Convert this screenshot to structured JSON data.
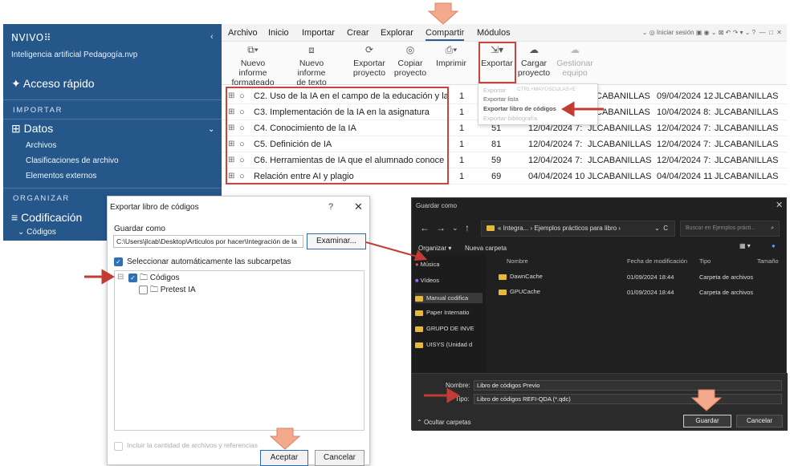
{
  "nvivo": {
    "logo": "NVIVO⠿",
    "project": "Inteligencia artificial Pedagogía.nvp",
    "quick_access": "Acceso rápido",
    "sec_import": "IMPORTAR",
    "group_data": "Datos",
    "sub_items": [
      "Archivos",
      "Clasificaciones de archivo",
      "Elementos externos"
    ],
    "sec_organize": "ORGANIZAR",
    "group_coding": "Codificación",
    "sub_codes": "Códigos",
    "menu": [
      "Archivo",
      "Inicio",
      "Importar",
      "Crear",
      "Explorar",
      "Compartir",
      "Módulos"
    ],
    "topright": "Iniciar sesión",
    "ribbon": [
      {
        "label": "Nuevo informe\nformateado",
        "icon": "report-icon"
      },
      {
        "label": "Nuevo informe\nde texto",
        "icon": "text-report-icon"
      },
      {
        "label": "Exportar\nproyecto",
        "icon": "export-project-icon"
      },
      {
        "label": "Copiar\nproyecto",
        "icon": "copy-project-icon"
      },
      {
        "label": "Imprimir",
        "icon": "print-icon"
      },
      {
        "label": "Exportar",
        "icon": "export-icon"
      },
      {
        "label": "Cargar\nproyecto",
        "icon": "upload-icon"
      },
      {
        "label": "Gestionar\nequipo",
        "icon": "team-icon"
      }
    ],
    "dropdown": [
      "Exportar",
      "Exportar lista",
      "Exportar libro de códigos",
      "Exportar bibliografía"
    ],
    "dropdown_shortcut": "CTRL+MAYÚSCULAS+E",
    "rows": [
      {
        "name": "C2. Uso de la IA en el campo de la educación y la",
        "files": "1",
        "refs": "",
        "created": "",
        "by": "CABANILLAS",
        "modified": "09/04/2024 12",
        "mby": "JLCABANILLAS"
      },
      {
        "name": "C3. Implementación de la IA en la asignatura",
        "files": "1",
        "refs": "",
        "created": "",
        "by": "CABANILLAS",
        "modified": "10/04/2024 8:",
        "mby": "JLCABANILLAS"
      },
      {
        "name": "C4. Conocimiento de la IA",
        "files": "1",
        "refs": "51",
        "created": "12/04/2024 7:",
        "by": "JLCABANILLAS",
        "modified": "12/04/2024 7:",
        "mby": "JLCABANILLAS"
      },
      {
        "name": "C5. Definición de IA",
        "files": "1",
        "refs": "81",
        "created": "12/04/2024 7:",
        "by": "JLCABANILLAS",
        "modified": "12/04/2024 7:",
        "mby": "JLCABANILLAS"
      },
      {
        "name": "C6. Herramientas de IA que el alumnado conoce",
        "files": "1",
        "refs": "59",
        "created": "12/04/2024 7:",
        "by": "JLCABANILLAS",
        "modified": "12/04/2024 7:",
        "mby": "JLCABANILLAS"
      },
      {
        "name": "Relación entre AI y plagio",
        "files": "1",
        "refs": "69",
        "created": "04/04/2024 10",
        "by": "JLCABANILLAS",
        "modified": "04/04/2024 11",
        "mby": "JLCABANILLAS"
      }
    ]
  },
  "export_dialog": {
    "title": "Exportar libro de códigos",
    "help": "?",
    "close": "✕",
    "save_as_label": "Guardar como",
    "path": "C:\\Users\\jlcab\\Desktop\\Articulos por hacer\\Integración de la",
    "browse": "Examinar...",
    "auto_select": "Seleccionar automáticamente las subcarpetas",
    "tree_root": "Códigos",
    "tree_child": "Pretest IA",
    "include_counts": "Incluir la cantidad de archivos y referencias",
    "ok": "Aceptar",
    "cancel": "Cancelar"
  },
  "save_dialog": {
    "title": "Guardar como",
    "close": "✕",
    "address": "« Integra... › Ejemplos prácticos para libro ›",
    "search_placeholder": "Buscar en Ejemplos prácti...",
    "organize": "Organizar ▾",
    "new_folder": "Nueva carpeta",
    "nav_items": [
      "Música",
      "Vídeos",
      "Manual codifica",
      "Paper Internatio",
      "GRUPO DE INVE",
      "UISYS (Unidad d"
    ],
    "col_name": "Nombre",
    "col_date": "Fecha de modificación",
    "col_type": "Tipo",
    "col_size": "Tamaño",
    "files": [
      {
        "name": "DawnCache",
        "date": "01/09/2024 18:44",
        "type": "Carpeta de archivos"
      },
      {
        "name": "GPUCache",
        "date": "01/09/2024 18:44",
        "type": "Carpeta de archivos"
      }
    ],
    "filename_label": "Nombre:",
    "filename": "Libro de códigos Previo",
    "type_label": "Tipo:",
    "type_value": "Libro de códigos REFI-QDA (*.qdc)",
    "hide_folders": "Ocultar carpetas",
    "save": "Guardar",
    "cancel": "Cancelar"
  },
  "colors": {
    "sidebar": "#25578b",
    "highlight": "#c8453e",
    "pointer": "#f2a98c",
    "arrow": "#c23b35",
    "dark": "#202020"
  }
}
